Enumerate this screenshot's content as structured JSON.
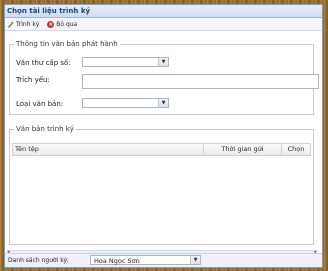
{
  "window": {
    "title": "Chọn tài liệu trình ký"
  },
  "toolbar": {
    "sign_label": "Trình ký",
    "cancel_label": "Bỏ qua"
  },
  "info_section": {
    "legend": "Thông tin văn bản phát hành",
    "van_thu_label": "Văn thư cấp số:",
    "van_thu_value": "",
    "trich_yeu_label": "Trích yếu:",
    "trich_yeu_value": "",
    "loai_label": "Loại văn bản:",
    "loai_value": ""
  },
  "docs_section": {
    "legend": "Văn bản trình ký",
    "columns": [
      "Tên tệp",
      "Thời gian gửi",
      "Chọn"
    ],
    "rows": []
  },
  "footer": {
    "label": "Danh sách người ký:",
    "selected": "Hoa Ngọc Sơn"
  },
  "colors": {
    "title_text": "#15428b",
    "cancel_icon": "#d32a2a"
  },
  "icons": {
    "sign": "pen-icon",
    "cancel": "cancel-x-icon"
  }
}
